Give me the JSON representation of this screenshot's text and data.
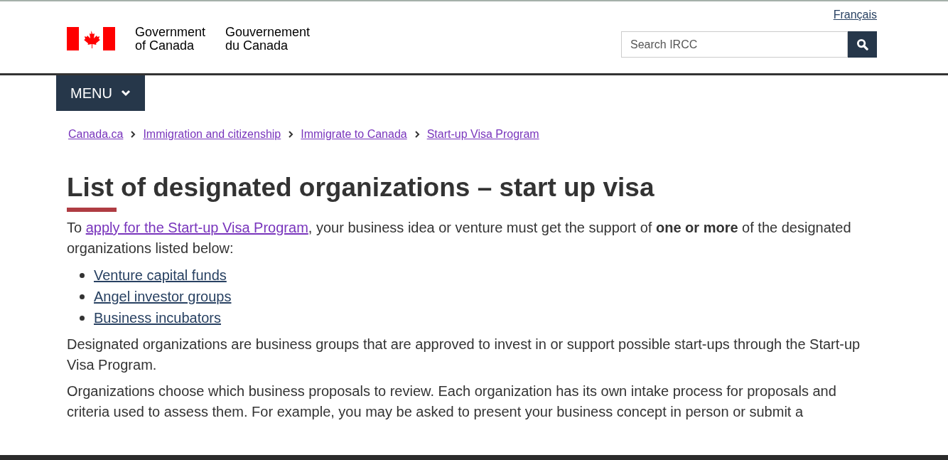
{
  "header": {
    "logo_line1_en": "Government",
    "logo_line2_en": "of Canada",
    "logo_line1_fr": "Gouvernement",
    "logo_line2_fr": "du Canada",
    "language_link": "Français",
    "search": {
      "placeholder": "Search IRCC"
    }
  },
  "menu": {
    "label": "MENU",
    "expanded": false
  },
  "breadcrumb": [
    "Canada.ca",
    "Immigration and citizenship",
    "Immigrate to Canada",
    "Start-up Visa Program"
  ],
  "title": "List of designated organizations – start up visa",
  "intro": [
    {
      "kind": "text",
      "text": "To "
    },
    {
      "kind": "link",
      "text": "apply for the Start-up Visa Program"
    },
    {
      "kind": "text",
      "text": ", your business idea or venture must get the support of **one or more** of the designated organizations listed below:"
    }
  ],
  "list": [
    "Venture capital funds",
    "Angel investor groups",
    "Business incubators"
  ],
  "paragraphs": [
    "Designated organizations are business groups that are approved to invest in or support possible start-ups through the Start-up Visa Program.",
    "Organizations choose which business proposals to review. Each organization has its own intake process for proposals and criteria used to assess them. For example, you may be asked to present your business concept in person or submit a"
  ]
}
